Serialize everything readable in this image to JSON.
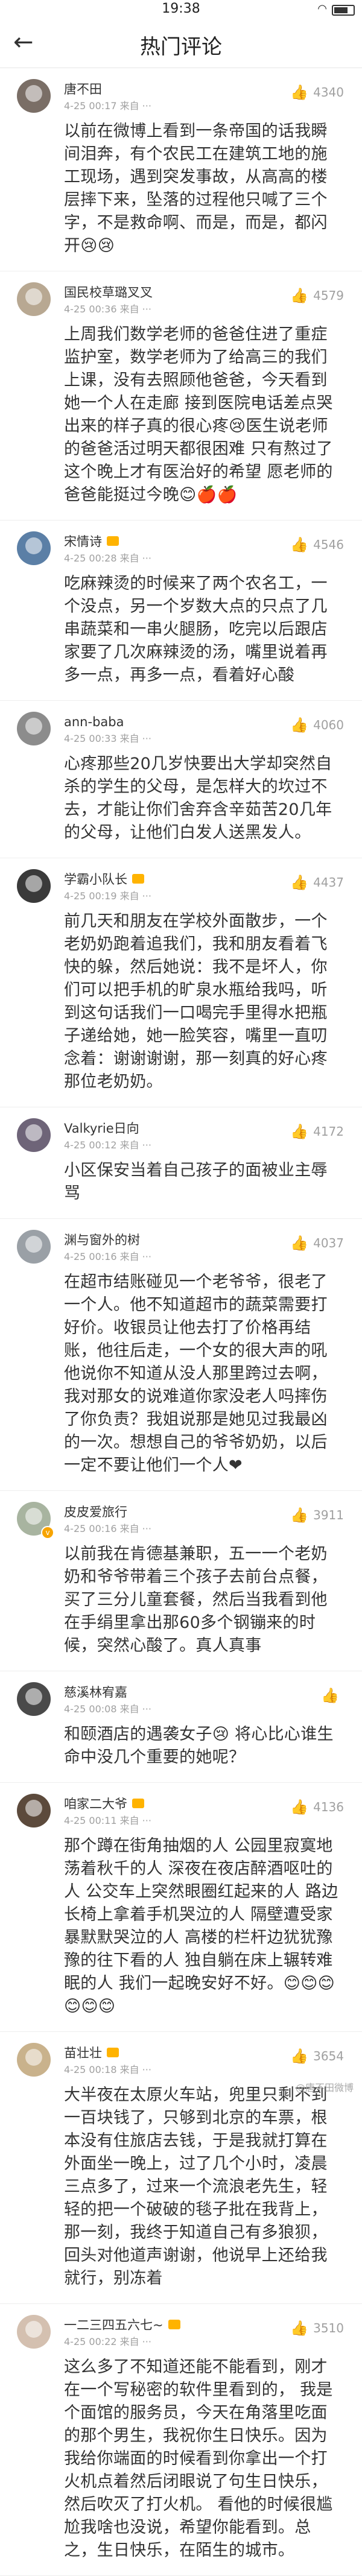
{
  "statusbar": {
    "time": "19:38"
  },
  "header": {
    "title": "热门评论",
    "back_icon": "back-arrow-icon"
  },
  "comments": [
    {
      "user": "唐不田",
      "date": "4-25 00:17 来自 ···",
      "likes": "4340",
      "text": "以前在微博上看到一条帝国的话我瞬间泪奔，有个农民工在建筑工地的施工现场，遇到突发事故，从高高的楼层摔下来，坠落的过程他只喊了三个字，不是救命啊、而是，而是，都闪开😢😢",
      "avatar_color": "#7a6e66"
    },
    {
      "user": "国民校草璐叉叉",
      "date": "4-25 00:36 来自 ···",
      "likes": "4579",
      "text": "上周我们数学老师的爸爸住进了重症监护室，数学老师为了给高三的我们上课，没有去照顾他爸爸，今天看到她一个人在走廊 接到医院电话差点哭出来的样子真的很心疼😢医生说老师的爸爸活过明天都很困难 只有熬过了这个晚上才有医治好的希望 愿老师的爸爸能挺过今晚😊🍎🍎",
      "avatar_color": "#b8a892"
    },
    {
      "user": "宋情诗",
      "date": "4-25 00:28 来自 ···",
      "likes": "4546",
      "text": "吃麻辣烫的时候来了两个农名工，一个没点，另一个岁数大点的只点了几串蔬菜和一串火腿肠，吃完以后跟店家要了几次麻辣烫的汤，嘴里说着再多一点，再多一点，看着好心酸",
      "avatar_color": "#5b7fa6",
      "vip": true
    },
    {
      "user": "ann-baba",
      "date": "4-25 00:33 来自 ···",
      "likes": "4060",
      "text": "心疼那些20几岁快要出大学却突然自杀的学生的父母，是怎样大的坎过不去，才能让你们舍弃含辛茹苦20几年的父母，让他们白发人送黑发人。",
      "avatar_color": "#8c8c8c"
    },
    {
      "user": "学霸小队长",
      "date": "4-25 00:19 来自 ···",
      "likes": "4437",
      "text": "前几天和朋友在学校外面散步，一个老奶奶跑着追我们，我和朋友看着飞快的躲，然后她说：我不是坏人，你们可以把手机的旷泉水瓶给我吗，听到这句话我们一口喝完手里得水把瓶子递给她，她一脸笑容，嘴里一直叨念着：谢谢谢谢，那一刻真的好心疼那位老奶奶。",
      "avatar_color": "#3a3a3a",
      "vip": true
    },
    {
      "user": "Valkyrie日向",
      "date": "4-25 00:12 来自 ···",
      "likes": "4172",
      "text": "小区保安当着自己孩子的面被业主辱骂",
      "avatar_color": "#6e6478"
    },
    {
      "user": "渊与窗外的树",
      "date": "4-25 00:16 来自 ···",
      "likes": "4037",
      "text": "在超市结账碰见一个老爷爷，很老了一个人。他不知道超市的蔬菜需要打好价。收银员让他去打了价格再结账，他往后走，一个女的很大声的吼他说你不知道从没人那里跨过去啊，我对那女的说难道你家没老人吗摔伤了你负责？我姐说那是她见过我最凶的一次。想想自己的爷爷奶奶，以后一定不要让他们一个人❤",
      "avatar_color": "#9aa0a6"
    },
    {
      "user": "皮皮爱旅行",
      "date": "4-25 00:16 来自 ···",
      "likes": "3911",
      "text": "以前我在肯德基兼职，五一一个老奶奶和爷爷带着三个孩子去前台点餐，买了三分儿童套餐，然后当我看到他在手绢里拿出那60多个钢镚来的时候，突然心酸了。真人真事",
      "avatar_color": "#a8b4a0",
      "verified": true
    },
    {
      "user": "慈溪林宥嘉",
      "date": "4-25 00:08 来自 ···",
      "likes": "",
      "text": "和颐酒店的遇袭女子😢 将心比心谁生命中没几个重要的她呢？",
      "avatar_color": "#4a4a4a"
    },
    {
      "user": "咱家二大爷",
      "date": "4-25 00:11 来自 ···",
      "likes": "4136",
      "text": "那个蹲在街角抽烟的人 公园里寂寞地荡着秋千的人 深夜在夜店醉酒呕吐的人 公交车上突然眼圈红起来的人 路边长椅上拿着手机哭泣的人 隔壁遭受家暴默默哭泣的人 高楼的栏杆边犹犹豫豫的往下看的人 独自躺在床上辗转难眠的人 我们一起晚安好不好。😊😊😊😊😊😊",
      "avatar_color": "#5c4a3c",
      "vip": true
    },
    {
      "user": "苗壮壮",
      "date": "4-25 00:18 来自 ···",
      "likes": "3654",
      "text": "大半夜在太原火车站，兜里只剩不到一百块钱了，只够到北京的车票，根本没有住旅店去钱，于是我就打算在外面坐一晚上，过了几个小时，凌晨三点多了，过来一个流浪老先生，轻轻的把一个破破的毯子批在我背上，那一刻，我终于知道自己有多狼狈，回头对他道声谢谢，他说早上还给我就行，别冻着",
      "avatar_color": "#c9b28c",
      "vip": true
    },
    {
      "user": "一二三四五六七~",
      "date": "4-25 00:22 来自 ···",
      "likes": "3510",
      "text": "这么多了不知道还能不能看到，刚才在一个写秘密的软件里看到的， 我是个面馆的服务员，今天在角落里吃面的那个男生，我祝你生日快乐。因为我给你端面的时候看到你拿出一个打火机点着然后闭眼说了句生日快乐，然后吹灭了打火机。 看他的时候很尴尬我啥也没说，希望你能看到。总之，生日快乐，在陌生的城市。",
      "avatar_color": "#d4c0b0",
      "vip": true
    }
  ],
  "watermark": "@唐不田微博"
}
